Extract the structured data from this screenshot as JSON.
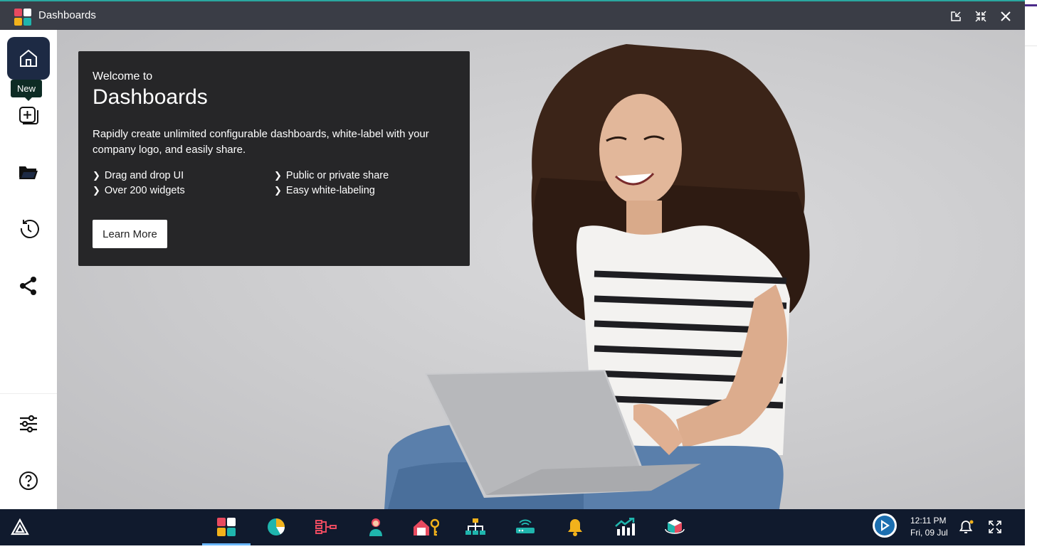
{
  "window": {
    "title": "Dashboards"
  },
  "sidebar": {
    "tooltip": "New",
    "items": [
      {
        "name": "home-icon"
      },
      {
        "name": "new-dashboard-icon"
      },
      {
        "name": "folder-icon"
      },
      {
        "name": "history-icon"
      },
      {
        "name": "share-icon"
      },
      {
        "name": "settings-sliders-icon"
      },
      {
        "name": "help-icon"
      }
    ]
  },
  "welcome_card": {
    "welcome_line": "Welcome to",
    "title": "Dashboards",
    "description": "Rapidly create unlimited configurable dashboards, white-label with your company logo, and easily share.",
    "features": [
      "Drag and drop UI",
      "Over 200 widgets",
      "Public or private share",
      "Easy white-labeling"
    ],
    "button": "Learn More"
  },
  "taskbar": {
    "apps": [
      "dashboards-app-icon",
      "pie-chart-app-icon",
      "flow-app-icon",
      "user-app-icon",
      "home-key-app-icon",
      "org-chart-app-icon",
      "router-app-icon",
      "bell-app-icon",
      "stocks-app-icon",
      "cube-app-icon"
    ],
    "time": "12:11 PM",
    "date": "Fri, 09 Jul"
  },
  "colors": {
    "titlebar": "#3a3d46",
    "taskbar": "#101a2d",
    "active_sidebar": "#1d2a44",
    "card": "#262628"
  }
}
